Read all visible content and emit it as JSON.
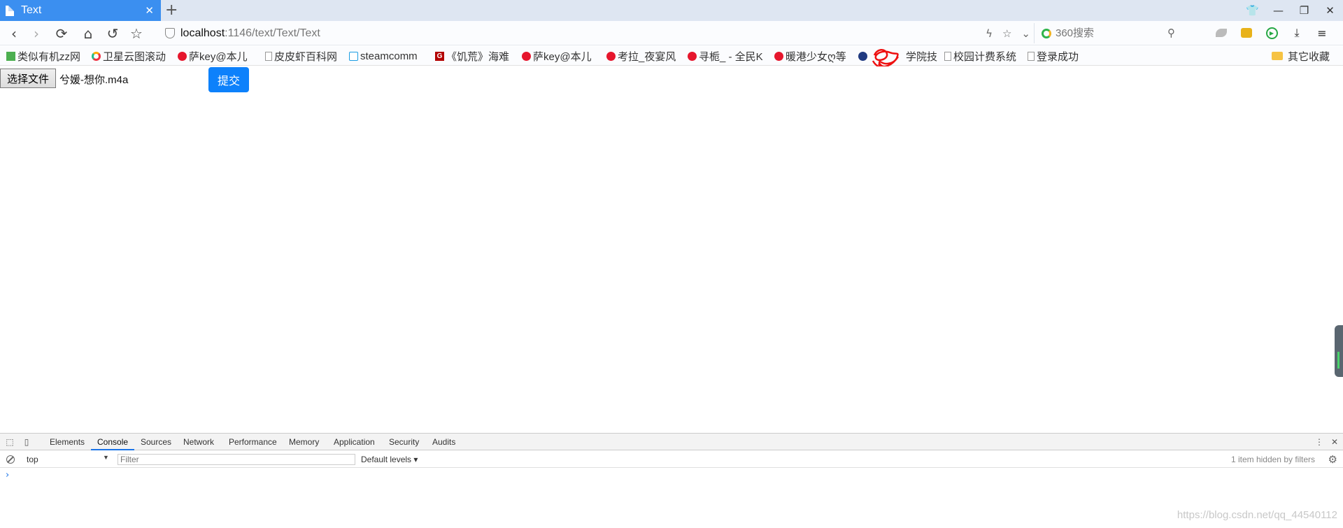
{
  "tab": {
    "title": "Text",
    "close_glyph": "✕",
    "new_tab_glyph": "+"
  },
  "window_controls": {
    "skin_icon": "👕",
    "minimize": "—",
    "restore": "❐",
    "close": "✕"
  },
  "nav": {
    "back": "‹",
    "forward": "›",
    "reload": "⟳",
    "home": "⌂",
    "undo": "↺",
    "star": "☆",
    "url_host": "localhost",
    "url_path": ":1146/text/Text/Text",
    "bolt": "ϟ",
    "fav_star": "☆",
    "dropdown": "⌄",
    "search_placeholder": "360搜索",
    "search_glyph": "⚲",
    "download": "⤓",
    "menu": "≡"
  },
  "bookmarks": {
    "items": [
      {
        "label": "类似有机zz网",
        "icon": "green-square-icon"
      },
      {
        "label": "卫星云图滚动",
        "icon": "swirl-icon"
      },
      {
        "label": "萨key@本儿",
        "icon": "weibo-icon"
      },
      {
        "label": "皮皮虾百科网",
        "icon": "page-icon"
      },
      {
        "label": "steamcomm",
        "icon": "steam-icon"
      },
      {
        "label": "《饥荒》海难",
        "icon": "g-icon"
      },
      {
        "label": "萨key@本儿",
        "icon": "weibo-icon"
      },
      {
        "label": "考拉_夜宴风",
        "icon": "weibo-icon"
      },
      {
        "label": "寻栀_ - 全民K",
        "icon": "weibo-icon"
      },
      {
        "label": "暖港少女ღ等",
        "icon": "weibo-icon"
      },
      {
        "label": "学院技",
        "icon": "globe-icon"
      },
      {
        "label": "校园计费系统",
        "icon": "page-icon"
      },
      {
        "label": "登录成功",
        "icon": "page-icon"
      }
    ],
    "other": "其它收藏"
  },
  "page": {
    "choose_file_label": "选择文件",
    "chosen_file": "兮媛-想你.m4a",
    "submit_label": "提交"
  },
  "devtools": {
    "tabs": [
      "Elements",
      "Console",
      "Sources",
      "Network",
      "Performance",
      "Memory",
      "Application",
      "Security",
      "Audits"
    ],
    "active_tab": "Console",
    "context": "top",
    "filter_placeholder": "Filter",
    "levels": "Default levels ▾",
    "hidden_note": "1 item hidden by filters",
    "prompt": "›",
    "kebab": "⋮",
    "close": "✕",
    "gear": "⚙"
  },
  "watermark": "https://blog.csdn.net/qq_44540112",
  "colors": {
    "tab_active": "#3b8ff0",
    "submit": "#0d81fb",
    "devtools_accent": "#1a73e8"
  }
}
